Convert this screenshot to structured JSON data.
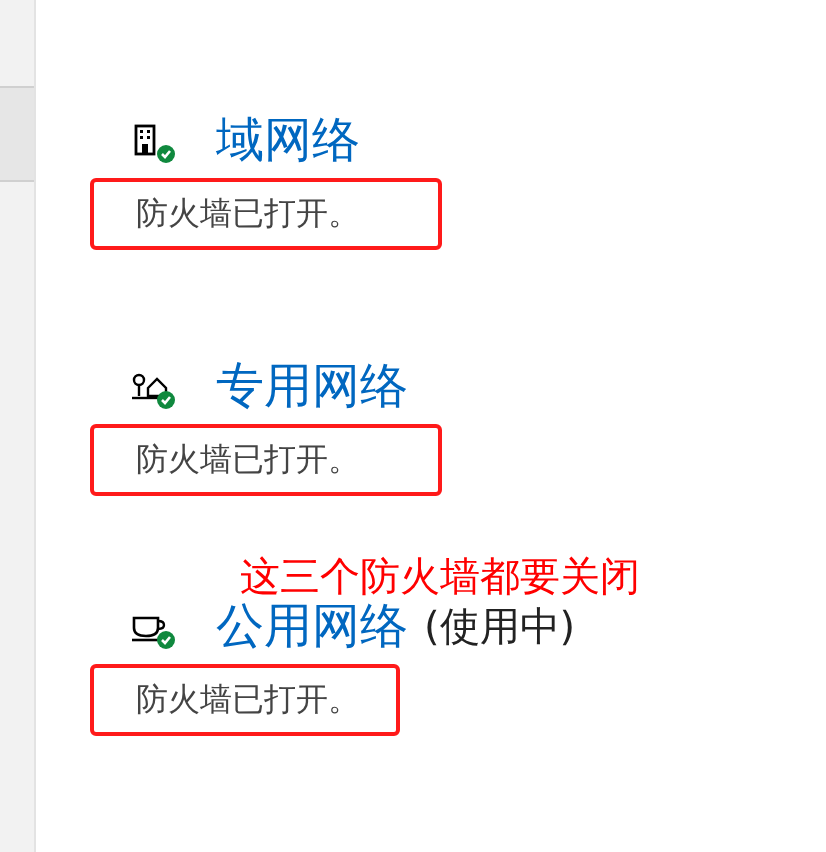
{
  "networks": [
    {
      "kind": "domain",
      "title": "域网络",
      "status": "防火墙已打开。",
      "highlighted": true
    },
    {
      "kind": "private",
      "title": "专用网络",
      "status": "防火墙已打开。",
      "highlighted": true
    },
    {
      "kind": "public",
      "title": "公用网络",
      "suffix": "(使用中)",
      "status": "防火墙已打开。",
      "highlighted": true
    }
  ],
  "annotation": "这三个防火墙都要关闭"
}
